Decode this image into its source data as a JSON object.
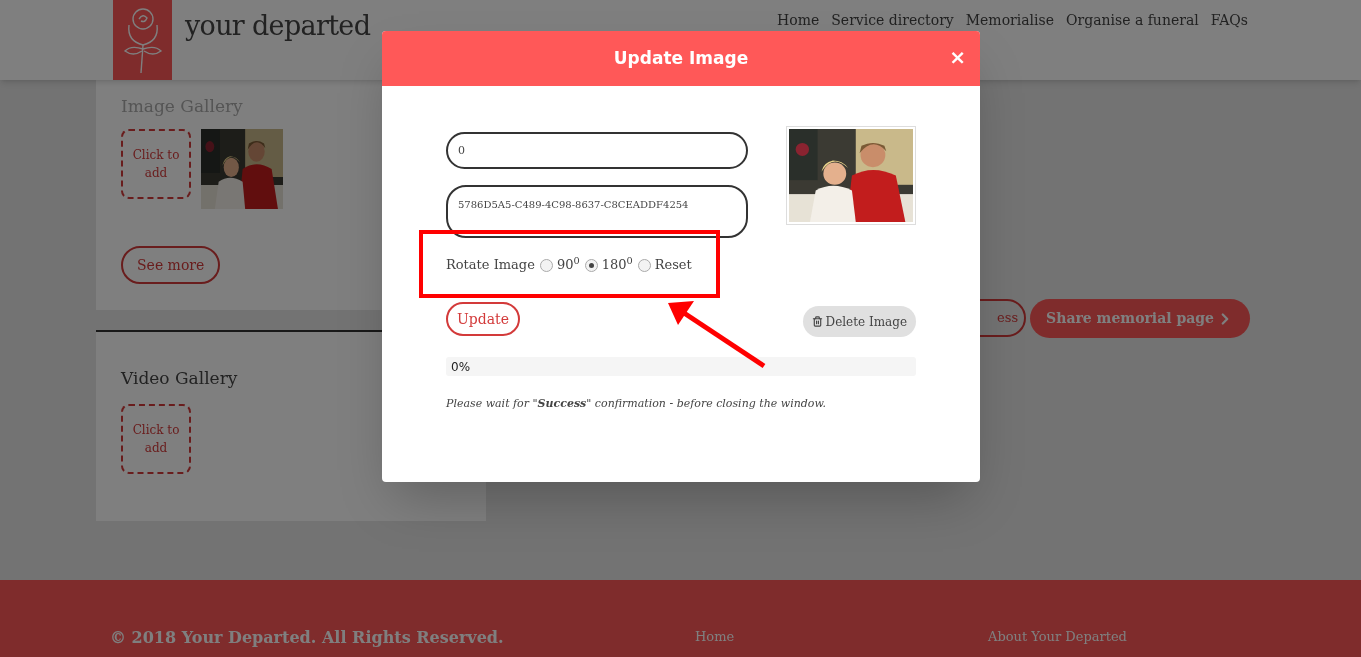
{
  "site": {
    "logo_text": "your departed",
    "nav": [
      {
        "label": "Home"
      },
      {
        "label": "Service directory"
      },
      {
        "label": "Memorialise"
      },
      {
        "label": "Organise a funeral"
      },
      {
        "label": "FAQs"
      }
    ]
  },
  "galleries": [
    {
      "title": "Image Gallery",
      "add_tile": "Click to add",
      "see_more": "See more"
    },
    {
      "title": "Video Gallery",
      "add_tile": "Click to add"
    }
  ],
  "actions": [
    {
      "label": "ess",
      "kind": "outline"
    },
    {
      "label": "Share memorial page",
      "kind": "filled"
    }
  ],
  "modal": {
    "title": "Update Image",
    "close": "×",
    "fields": [
      {
        "kind": "input",
        "value": "0"
      },
      {
        "kind": "textarea",
        "value": "5786D5A5-C489-4C98-8637-C8CEADDF4254"
      }
    ],
    "rotate": {
      "label": "Rotate Image",
      "options": [
        {
          "label": "90$^{0}$",
          "selected": false
        },
        {
          "label": "180$^{0}$",
          "selected": true
        },
        {
          "label": "Reset",
          "selected": false
        }
      ]
    },
    "update_button": "Update",
    "delete_button": "Delete Image",
    "progress": {
      "level": 0,
      "reading": "0%"
    },
    "note": "Please wait for \"**Success**\" confirmation - before closing the window."
  },
  "footer": {
    "copyright": "© 2018 Your Departed. All Rights Reserved.",
    "links": [
      {
        "label": "Home"
      },
      {
        "label": "About Your Departed"
      }
    ]
  }
}
